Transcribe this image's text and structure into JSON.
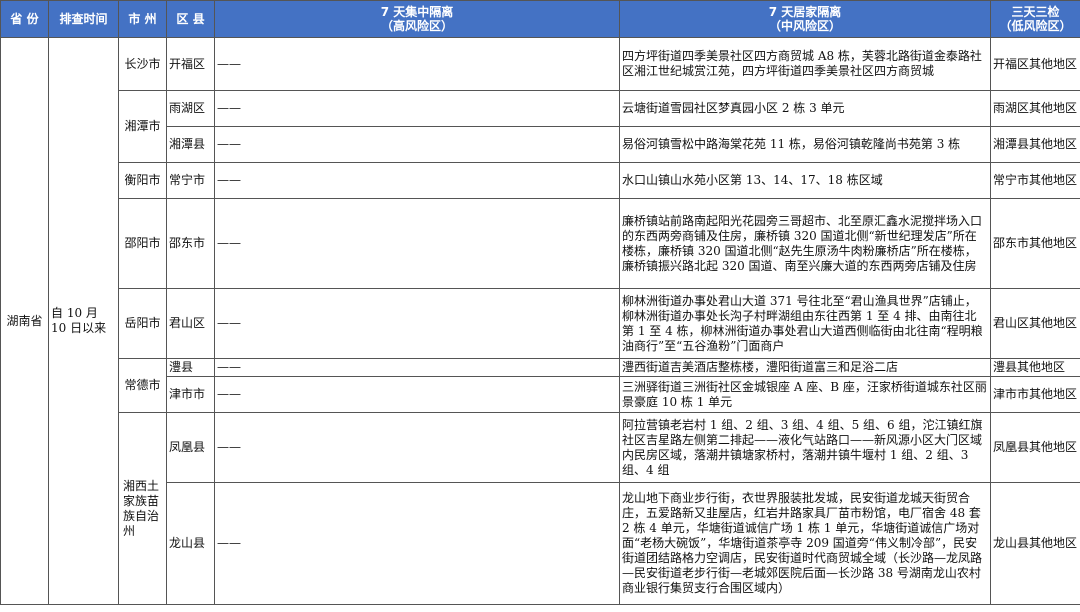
{
  "header": {
    "province": "省 份",
    "time": "排查时间",
    "city": "市 州",
    "county": "区 县",
    "col_high": [
      "7 天集中隔离",
      "（高风险区）"
    ],
    "col_mid": [
      "7 天居家隔离",
      "（中风险区）"
    ],
    "col_low": [
      "三天三检",
      "（低风险区）"
    ]
  },
  "province": "湖南省",
  "time": "自 10 月 10 日以来",
  "rows": [
    {
      "city": "长沙市",
      "county": "开福区",
      "high": "——",
      "mid": "四方坪街道四季美景社区四方商贸城 A8 栋，芙蓉北路街道金泰路社区湘江世纪城赏江苑，四方坪街道四季美景社区四方商贸城",
      "low": "开福区其他地区"
    },
    {
      "city": "湘潭市",
      "county": "雨湖区",
      "high": "——",
      "mid": "云塘街道雪园社区梦真园小区 2 栋 3 单元",
      "low": "雨湖区其他地区"
    },
    {
      "county": "湘潭县",
      "high": "——",
      "mid": "易俗河镇雪松中路海棠花苑 11 栋，易俗河镇乾隆尚书苑第 3 栋",
      "low": "湘潭县其他地区"
    },
    {
      "city": "衡阳市",
      "county": "常宁市",
      "high": "——",
      "mid": "水口山镇山水苑小区第 13、14、17、18 栋区域",
      "low": "常宁市其他地区"
    },
    {
      "city": "邵阳市",
      "county": "邵东市",
      "high": "——",
      "mid": "廉桥镇站前路南起阳光花园旁三哥超市、北至原汇鑫水泥搅拌场入口的东西两旁商铺及住房，廉桥镇 320 国道北侧“新世纪理发店”所在楼栋，廉桥镇 320 国道北侧“赵先生原汤牛肉粉廉桥店”所在楼栋，廉桥镇振兴路北起 320 国道、南至兴廉大道的东西两旁店铺及住房",
      "low": "邵东市其他地区"
    },
    {
      "city": "岳阳市",
      "county": "君山区",
      "high": "——",
      "mid": "柳林洲街道办事处君山大道 371 号往北至“君山渔具世界”店铺止，柳林洲街道办事处长沟子村畔湖组由东往西第 1 至 4 排、由南往北第 1 至 4 栋，柳林洲街道办事处君山大道西侧临街由北往南“程明粮油商行”至“五谷渔粉”门面商户",
      "low": "君山区其他地区"
    },
    {
      "city": "常德市",
      "county": "澧县",
      "high": "——",
      "mid": "澧西街道吉美酒店整栋楼，澧阳街道富三和足浴二店",
      "low": "澧县其他地区"
    },
    {
      "county": "津市市",
      "high": "——",
      "mid": "三洲驿街道三洲街社区金城银座 A 座、B 座，汪家桥街道城东社区丽景豪庭 10 栋 1 单元",
      "low": "津市市其他地区"
    },
    {
      "city": "湘西土家族苗族自治州",
      "county": "凤凰县",
      "high": "——",
      "mid": "阿拉营镇老岩村 1 组、2 组、3 组、4 组、5 组、6 组，沱江镇红旗社区吉星路左侧第二排起——液化气站路口——新风源小区大门区域内民房区域，落潮井镇塘家桥村，落潮井镇牛堰村 1 组、2 组、3 组、4 组",
      "low": "凤凰县其他地区"
    },
    {
      "county": "龙山县",
      "high": "——",
      "mid": "龙山地下商业步行街，衣世界服装批发城，民安街道龙城天街贸合庄，五爱路新又韭屋店，红岩井路家具厂苗市粉馆，电厂宿舍 48 套 2 栋 4 单元，华塘街道诚信广场 1 栋 1 单元，华塘街道诚信广场对面“老杨大碗饭”，华塘街道茶亭寺 209 国道旁“伟义制冷部”，民安街道团结路格力空调店，民安街道时代商贸城全域（长沙路—龙凤路—民安街道老步行街—老城郊医院后面—长沙路 38 号湖南龙山农村商业银行集贸支行合围区域内）",
      "low": "龙山县其他地区"
    }
  ]
}
